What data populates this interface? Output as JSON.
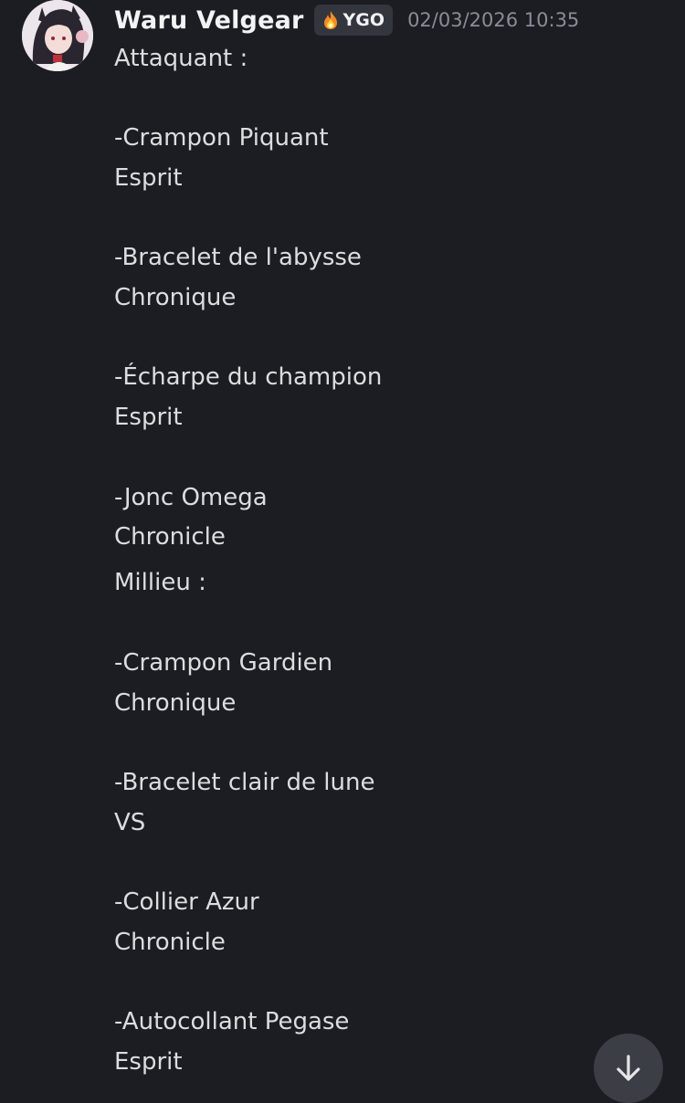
{
  "message": {
    "author": "Waru Velgear",
    "tag": {
      "icon": "flame-icon",
      "label": "YGO"
    },
    "timestamp": "02/03/2026 10:35",
    "lines": [
      "Attaquant :",
      "-Crampon Piquant",
      "Esprit",
      "-Bracelet de l'abysse",
      "Chronique",
      "-Écharpe du champion",
      "Esprit",
      "-Jonc Omega",
      "Chronicle",
      "Millieu :",
      "-Crampon Gardien",
      "Chronique",
      "-Bracelet clair de lune",
      "VS",
      "-Collier Azur",
      "Chronicle",
      "-Autocollant Pegase",
      "Esprit"
    ]
  },
  "scroll_button": {
    "icon": "arrow-down-icon"
  }
}
